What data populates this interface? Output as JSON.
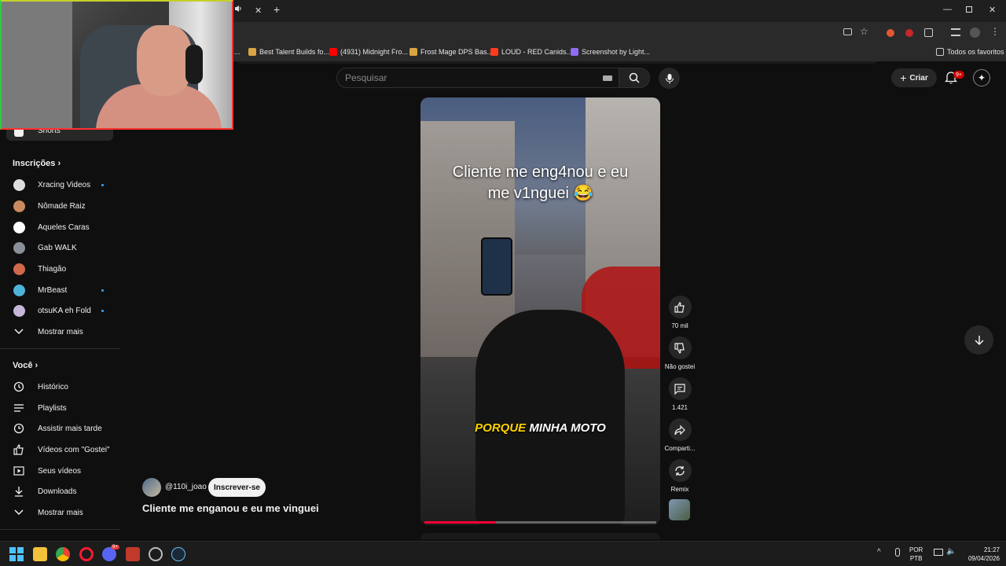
{
  "browser": {
    "bookmarks": [
      {
        "label": "...",
        "color": "#888888"
      },
      {
        "label": "Best Talent Builds fo...",
        "color": "#d9a441"
      },
      {
        "label": "(4931) Midnight Fro...",
        "color": "#ff0000"
      },
      {
        "label": "Frost Mage DPS Bas...",
        "color": "#d9a441"
      },
      {
        "label": "LOUD - RED Canids...",
        "color": "#ff3b1f"
      },
      {
        "label": "Screenshot by Light...",
        "color": "#8e6cf0"
      }
    ],
    "all_bookmarks_label": "Todos os favoritos"
  },
  "header": {
    "search_placeholder": "Pesquisar",
    "create_label": "Criar",
    "notifications_badge": "9+"
  },
  "sidebar": {
    "shorts_label": "Shorts",
    "subscriptions_title": "Inscrições",
    "subscriptions": [
      {
        "name": "Xracing Videos",
        "new": true,
        "color": "#dddddd"
      },
      {
        "name": "Nômade Raiz",
        "new": false,
        "color": "#c98a5e"
      },
      {
        "name": "Aqueles Caras",
        "new": false,
        "color": "#ffffff"
      },
      {
        "name": "Gab WALK",
        "new": false,
        "color": "#8a8f99"
      },
      {
        "name": "Thiagão",
        "new": false,
        "color": "#d0694b"
      },
      {
        "name": "MrBeast",
        "new": true,
        "color": "#4fb3d9"
      },
      {
        "name": "otsuKA eh Fold",
        "new": true,
        "color": "#c6b6d8"
      }
    ],
    "subscriptions_more": "Mostrar mais",
    "you_title": "Você",
    "you_items": [
      {
        "label": "Histórico",
        "icon": "history-icon"
      },
      {
        "label": "Playlists",
        "icon": "playlists-icon"
      },
      {
        "label": "Assistir mais tarde",
        "icon": "watch-later-icon"
      },
      {
        "label": "Vídeos com \"Gostei\"",
        "icon": "liked-icon"
      },
      {
        "label": "Seus vídeos",
        "icon": "your-videos-icon"
      },
      {
        "label": "Downloads",
        "icon": "download-icon"
      }
    ],
    "you_more": "Mostrar mais"
  },
  "video": {
    "caption_line1": "Cliente me eng4nou e eu",
    "caption_line2": "me v1nguei 😂",
    "subtitle_highlight": "PORQUE",
    "subtitle_rest": " MINHA MOTO",
    "progress_fraction": 0.31,
    "channel_handle": "@110i_joao",
    "subscribe_label": "Inscrever-se",
    "title": "Cliente me enganou e eu me vinguei"
  },
  "actions": {
    "like_count": "70 mil",
    "dislike_label": "Não gostei",
    "comments_count": "1.421",
    "share_label": "Comparti...",
    "remix_label": "Remix"
  },
  "taskbar": {
    "lang_line1": "POR",
    "lang_line2": "PTB",
    "time": "21:27",
    "date": "09/04/2026",
    "discord_badge": "9+"
  }
}
